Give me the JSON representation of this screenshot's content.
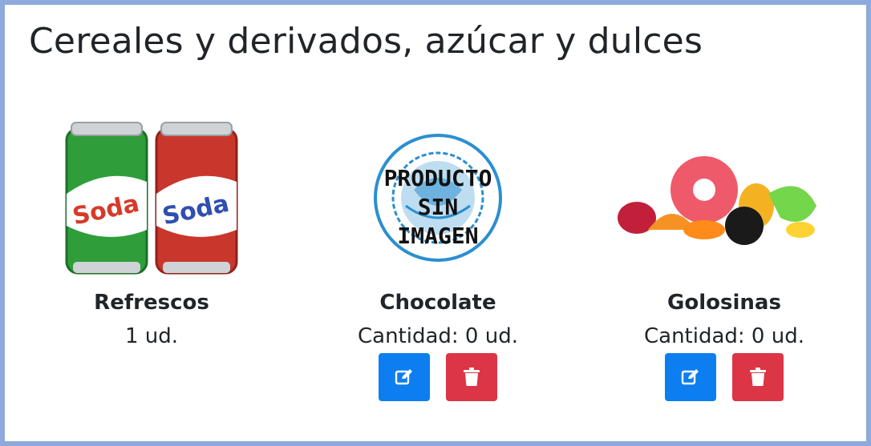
{
  "section": {
    "title": "Cereales y derivados, azúcar y dulces"
  },
  "products": [
    {
      "name": "Refrescos",
      "quantity": "1 ud.",
      "image": "soda-cans",
      "actions": false
    },
    {
      "name": "Chocolate",
      "quantity": "Cantidad: 0 ud.",
      "image": "no-image-placeholder",
      "placeholder_text": [
        "PRODUCTO",
        "SIN",
        "IMAGEN"
      ],
      "actions": true
    },
    {
      "name": "Golosinas",
      "quantity": "Cantidad: 0 ud.",
      "image": "gummy-candies",
      "actions": true
    }
  ],
  "colors": {
    "edit": "#0d7ef0",
    "delete": "#dc3545",
    "border": "#8ea9db",
    "seal": "#2b8fd0"
  },
  "icons": {
    "edit": "edit-icon",
    "delete": "trash-icon"
  }
}
